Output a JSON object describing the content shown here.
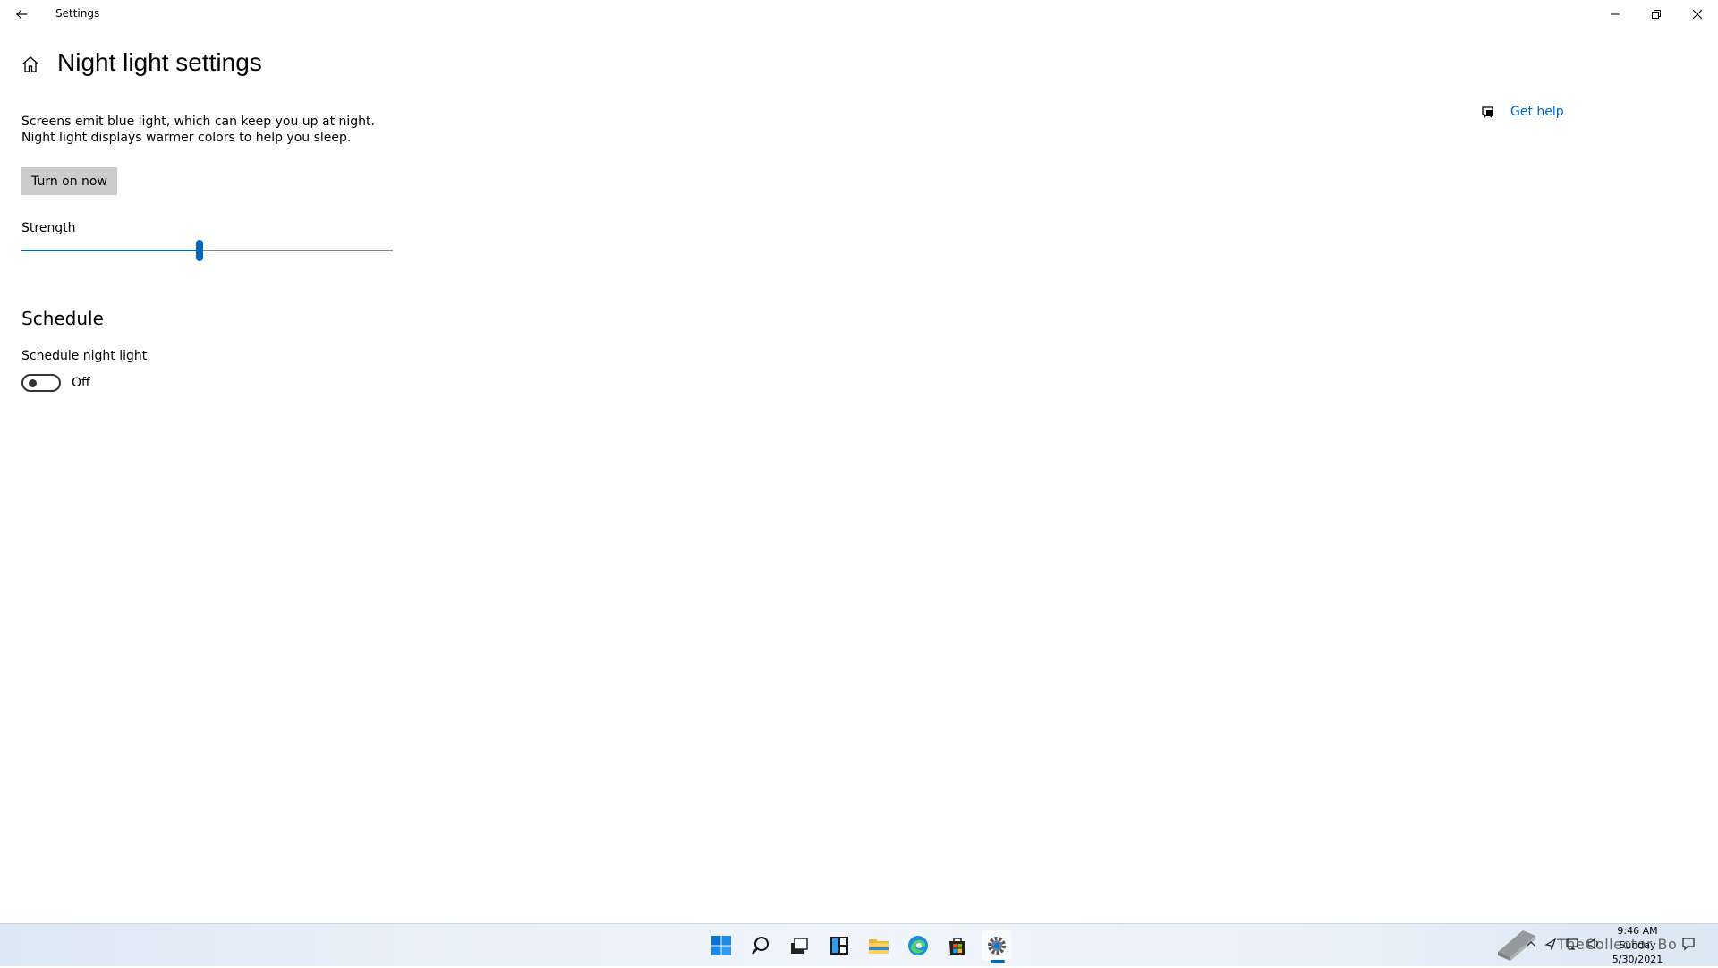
{
  "window": {
    "title": "Settings"
  },
  "page": {
    "title": "Night light settings",
    "description": "Screens emit blue light, which can keep you up at night. Night light displays warmer colors to help you sleep.",
    "turn_on_label": "Turn on now",
    "strength_label": "Strength",
    "strength_value_percent": 48,
    "schedule_title": "Schedule",
    "schedule_label": "Schedule night light",
    "schedule_state": "Off",
    "help_label": "Get help"
  },
  "taskbar": {
    "apps": [
      "windows-start-icon",
      "search-icon",
      "task-view-icon",
      "widgets-icon",
      "file-explorer-icon",
      "edge-icon",
      "store-icon",
      "settings-icon"
    ],
    "active_app": "settings-icon",
    "clock": {
      "time": "9:46 AM",
      "day": "Sunday",
      "date": "5/30/2021"
    },
    "watermark": "TheCollector Bo"
  },
  "colors": {
    "accent": "#0067c0",
    "button_bg": "#cccccc"
  }
}
